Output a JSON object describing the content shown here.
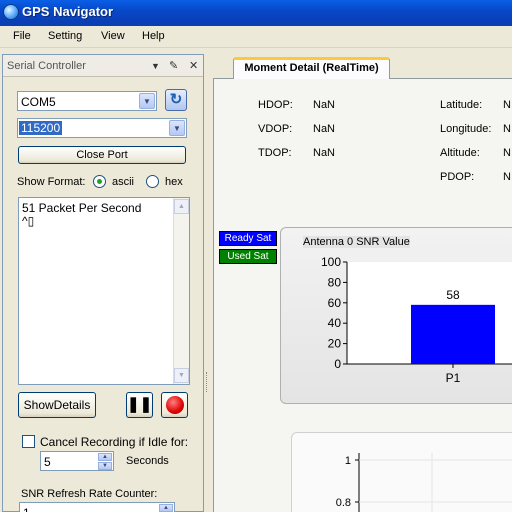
{
  "window": {
    "title": "GPS Navigator"
  },
  "menu": [
    "File",
    "Setting",
    "View",
    "Help"
  ],
  "serial": {
    "panel_title": "Serial Controller",
    "port": "COM5",
    "baud": "115200",
    "close_port": "Close Port",
    "show_format_label": "Show Format:",
    "format_ascii": "ascii",
    "format_hex": "hex",
    "selected_format": "ascii",
    "output_lines": [
      "51 Packet Per Second",
      "^▯"
    ],
    "show_details": "ShowDetails",
    "cancel_recording_label": "Cancel Recording if Idle for:",
    "cancel_recording_checked": false,
    "idle_value": "5",
    "idle_unit": "Seconds",
    "snr_refresh_label": "SNR Refresh Rate Counter:",
    "snr_refresh_value": "1"
  },
  "tab": {
    "label": "Moment Detail (RealTime)"
  },
  "detail": {
    "hdop_label": "HDOP:",
    "hdop": "NaN",
    "vdop_label": "VDOP:",
    "vdop": "NaN",
    "tdop_label": "TDOP:",
    "tdop": "NaN",
    "lat_label": "Latitude:",
    "lat": "N",
    "lon_label": "Longitude:",
    "lon": "N",
    "alt_label": "Altitude:",
    "alt": "N",
    "pdop_label": "PDOP:",
    "pdop": "N"
  },
  "legend": {
    "ready": "Ready Sat",
    "ready_color": "#0000ff",
    "used": "Used Sat",
    "used_color": "#008000"
  },
  "chart_data": {
    "type": "bar",
    "title": "Antenna 0 SNR Value",
    "categories": [
      "P1"
    ],
    "values": [
      58
    ],
    "ylim": [
      0,
      100
    ],
    "yticks": [
      0,
      20,
      40,
      60,
      80,
      100
    ],
    "bar_color": "#0000ff"
  },
  "chart2": {
    "yticks": [
      "1",
      "0.8"
    ]
  }
}
